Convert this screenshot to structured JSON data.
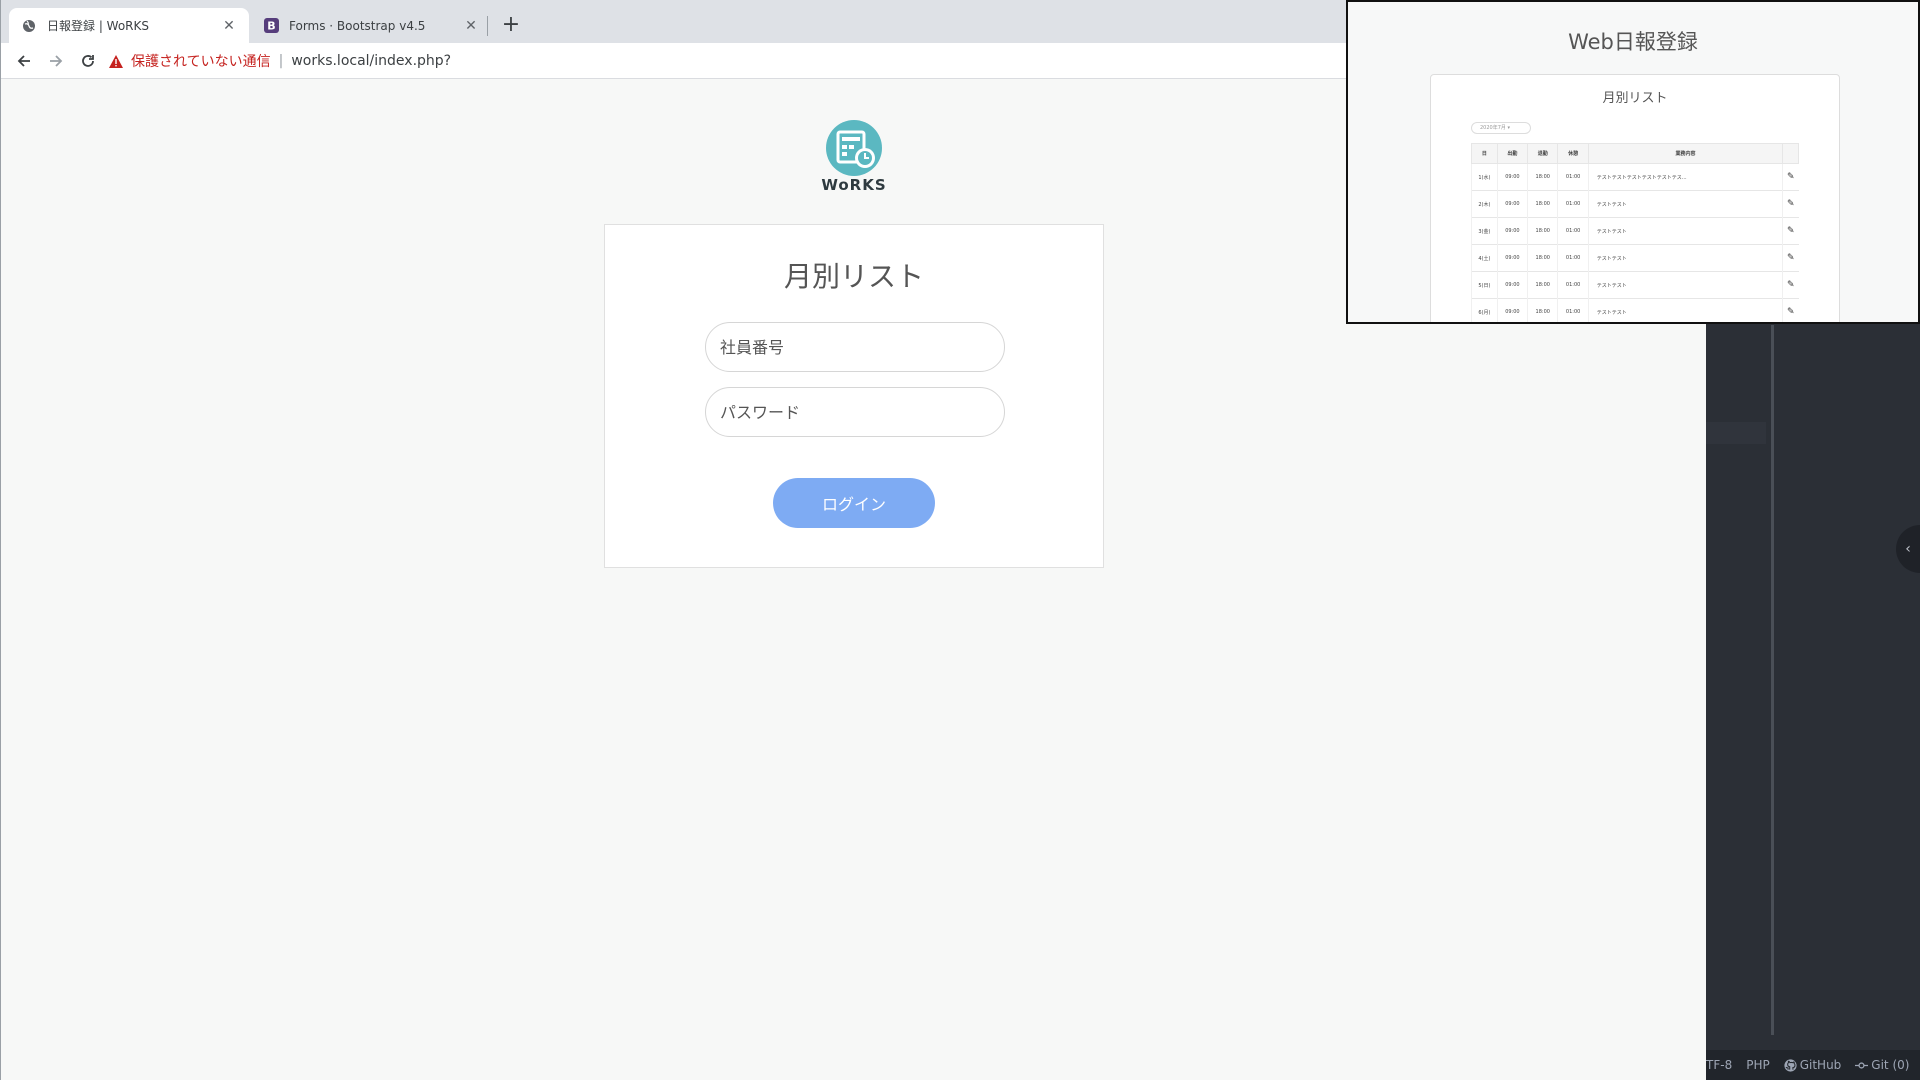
{
  "browser": {
    "tabs": [
      {
        "title": "日報登録 | WoRKS",
        "active": true
      },
      {
        "title": "Forms · Bootstrap v4.5",
        "active": false
      }
    ],
    "security_warning": "保護されていない通信",
    "url": "works.local/index.php?"
  },
  "page": {
    "logo_text": "WoRKS",
    "card_title": "月別リスト",
    "employee_placeholder": "社員番号",
    "password_placeholder": "パスワード",
    "login_label": "ログイン"
  },
  "overlay": {
    "title": "Web日報登録",
    "card_title": "月別リスト",
    "month_select": "2020年7月",
    "columns": [
      "日",
      "出勤",
      "退勤",
      "休憩",
      "業務内容"
    ],
    "rows": [
      {
        "day": "1(水)",
        "in": "09:00",
        "out": "18:00",
        "break": "01:00",
        "work": "テストテストテストテストテストテス..."
      },
      {
        "day": "2(木)",
        "in": "09:00",
        "out": "18:00",
        "break": "01:00",
        "work": "テストテスト"
      },
      {
        "day": "3(金)",
        "in": "09:00",
        "out": "18:00",
        "break": "01:00",
        "work": "テストテスト"
      },
      {
        "day": "4(土)",
        "in": "09:00",
        "out": "18:00",
        "break": "01:00",
        "work": "テストテスト"
      },
      {
        "day": "5(日)",
        "in": "09:00",
        "out": "18:00",
        "break": "01:00",
        "work": "テストテスト"
      },
      {
        "day": "6(月)",
        "in": "09:00",
        "out": "18:00",
        "break": "01:00",
        "work": "テストテスト"
      }
    ]
  },
  "statusbar": {
    "encoding": "TF-8",
    "language": "PHP",
    "github": "GitHub",
    "git": "Git (0)"
  },
  "colors": {
    "accent_button": "#7eabf3",
    "logo_teal": "#5bb8c1",
    "warning_red": "#c5221f"
  }
}
